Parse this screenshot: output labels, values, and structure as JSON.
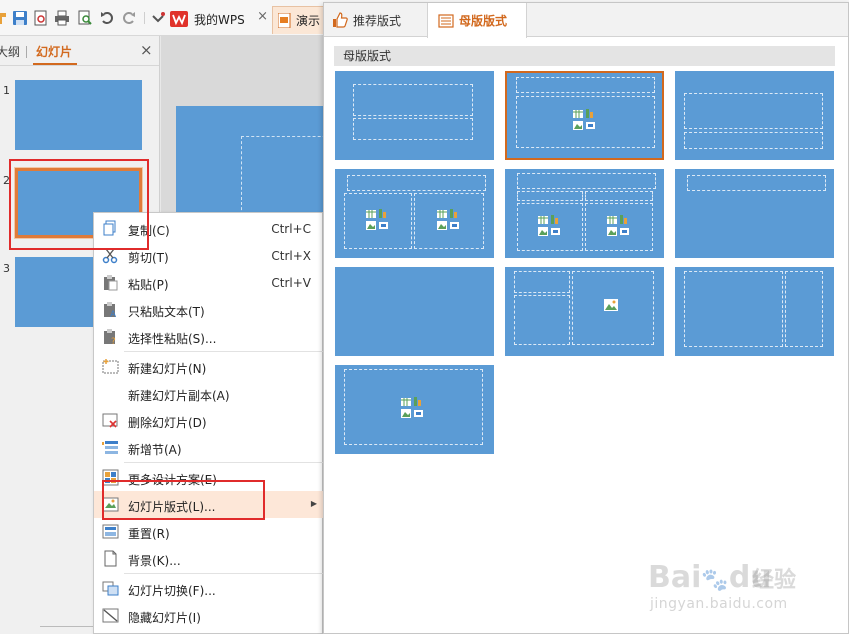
{
  "toolbar": {
    "tab_wps": "我的WPS",
    "tab_doc": "演示",
    "close_glyph": "×"
  },
  "left_panel": {
    "tab_outline": "大纲",
    "tab_slides": "幻灯片",
    "close_glyph": "×",
    "slides": [
      {
        "num": "1"
      },
      {
        "num": "2"
      },
      {
        "num": "3"
      }
    ]
  },
  "context_menu": {
    "items": [
      {
        "label": "复制(C)",
        "shortcut": "Ctrl+C"
      },
      {
        "label": "剪切(T)",
        "shortcut": "Ctrl+X"
      },
      {
        "label": "粘贴(P)",
        "shortcut": "Ctrl+V"
      },
      {
        "label": "只粘贴文本(T)",
        "shortcut": ""
      },
      {
        "label": "选择性粘贴(S)...",
        "shortcut": ""
      },
      {
        "label": "新建幻灯片(N)",
        "shortcut": ""
      },
      {
        "label": "新建幻灯片副本(A)",
        "shortcut": ""
      },
      {
        "label": "删除幻灯片(D)",
        "shortcut": ""
      },
      {
        "label": "新增节(A)",
        "shortcut": ""
      },
      {
        "label": "更多设计方案(E)",
        "shortcut": ""
      },
      {
        "label": "幻灯片版式(L)...",
        "shortcut": ""
      },
      {
        "label": "重置(R)",
        "shortcut": ""
      },
      {
        "label": "背景(K)...",
        "shortcut": ""
      },
      {
        "label": "幻灯片切换(F)...",
        "shortcut": ""
      },
      {
        "label": "隐藏幻灯片(I)",
        "shortcut": ""
      }
    ],
    "submenu_arrow": "▶"
  },
  "layout_panel": {
    "tab_recommended": "推荐版式",
    "tab_master": "母版版式",
    "section_title": "母版版式"
  },
  "watermark": {
    "brand": "Bai",
    "brand2": "du",
    "suffix": "经验",
    "url": "jingyan.baidu.com"
  },
  "colors": {
    "accent": "#d2691e",
    "slide_blue": "#5b9bd5",
    "highlight_red": "#e02b2b",
    "menu_hover": "#fde7d8"
  }
}
